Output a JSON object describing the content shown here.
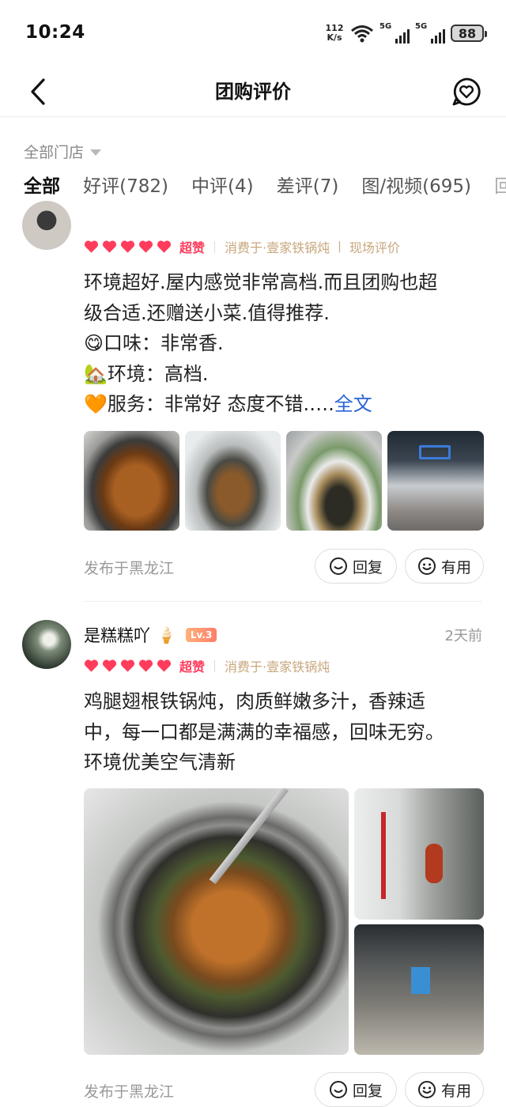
{
  "status_bar": {
    "time": "10:24",
    "net_speed_value": "112",
    "net_speed_unit": "K/s",
    "signal1_label": "5G",
    "signal2_label": "5G",
    "battery": "88"
  },
  "header": {
    "title": "团购评价",
    "back_icon": "chevron-left-icon",
    "action_icon": "heart-chat-icon"
  },
  "filter": {
    "store_label": "全部门店"
  },
  "tabs": [
    {
      "label": "全部"
    },
    {
      "label": "好评(782)"
    },
    {
      "label": "中评(4)"
    },
    {
      "label": "差评(7)"
    },
    {
      "label": "图/视频(695)"
    },
    {
      "label": "回"
    }
  ],
  "colors": {
    "accent": "#ff3c5c",
    "meta": "#c7a77d",
    "link": "#2b64d6"
  },
  "reviews": [
    {
      "rating_label": "超赞",
      "hearts": 5,
      "meta_consumed": "消费于·壹家铁锅炖",
      "meta_type": "现场评价",
      "text_lines": [
        "环境超好.屋内感觉非常高档.而且团购也超",
        "级合适.还赠送小菜.值得推荐.",
        "😋口味：非常香.",
        "🏡环境：高档.",
        "🧡服务：非常好 态度不错.…."
      ],
      "full_text_link": "全文",
      "location": "发布于黑龙江",
      "reply_label": "回复",
      "useful_label": "有用"
    },
    {
      "user_name": "是糕糕吖",
      "name_emoji": "🍦",
      "level": "Lv.3",
      "time": "2天前",
      "rating_label": "超赞",
      "hearts": 5,
      "meta_consumed": "消费于·壹家铁锅炖",
      "text_lines": [
        "鸡腿翅根铁锅炖，肉质鲜嫩多汁，香辣适",
        "中，每一口都是满满的幸福感，回味无穷。",
        "环境优美空气清新"
      ],
      "location": "发布于黑龙江",
      "reply_label": "回复",
      "useful_label": "有用"
    }
  ]
}
